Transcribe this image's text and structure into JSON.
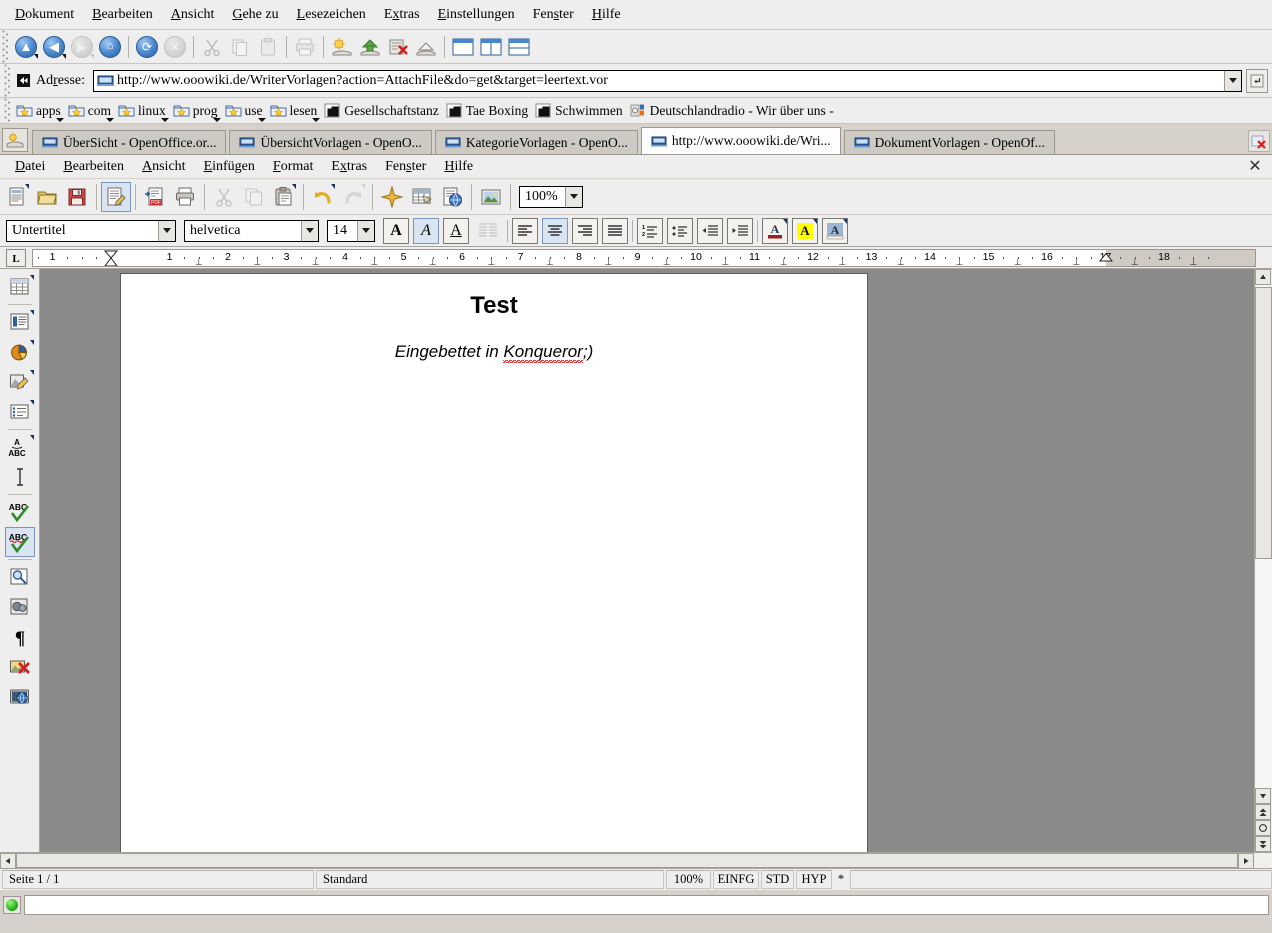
{
  "konqueror": {
    "menu": [
      "Dokument",
      "Bearbeiten",
      "Ansicht",
      "Gehe zu",
      "Lesezeichen",
      "Extras",
      "Einstellungen",
      "Fenster",
      "Hilfe"
    ],
    "toolbar_icons": [
      "up-icon",
      "back-icon",
      "forward-icon",
      "home-icon",
      "reload-icon",
      "stop-icon",
      "cut-icon",
      "copy-icon",
      "paste-icon",
      "print-icon",
      "new-window-icon",
      "save-icon",
      "close-icon",
      "open-icon",
      "view-single-icon",
      "view-split-vertical-icon",
      "view-split-horizontal-icon"
    ],
    "address": {
      "label": "Adresse:",
      "value": "http://www.ooowiki.de/WriterVorlagen?action=AttachFile&do=get&target=leertext.vor"
    },
    "bookmarks": [
      {
        "label": "apps",
        "icon": "folder-bookmark-icon",
        "type": "folder"
      },
      {
        "label": "com",
        "icon": "folder-bookmark-icon",
        "type": "folder"
      },
      {
        "label": "linux",
        "icon": "folder-bookmark-icon",
        "type": "folder"
      },
      {
        "label": "prog",
        "icon": "folder-bookmark-icon",
        "type": "folder"
      },
      {
        "label": "use",
        "icon": "folder-bookmark-icon",
        "type": "folder"
      },
      {
        "label": "lesen",
        "icon": "folder-bookmark-icon",
        "type": "folder"
      },
      {
        "label": "Gesellschaftstanz",
        "icon": "page-dark-icon",
        "type": "link"
      },
      {
        "label": "Tae Boxing",
        "icon": "page-dark-icon",
        "type": "link"
      },
      {
        "label": "Schwimmen",
        "icon": "page-dark-icon",
        "type": "link"
      },
      {
        "label": "Deutschlandradio - Wir über uns -",
        "icon": "dlr-site-icon",
        "type": "link"
      }
    ],
    "tabs": [
      {
        "label": "ÜberSicht - OpenOffice.or...",
        "active": false
      },
      {
        "label": "ÜbersichtVorlagen - OpenO...",
        "active": false
      },
      {
        "label": "KategorieVorlagen - OpenO...",
        "active": false
      },
      {
        "label": "http://www.ooowiki.de/Wri...",
        "active": true
      },
      {
        "label": "DokumentVorlagen - OpenOf...",
        "active": false
      }
    ],
    "status": {
      "text": ""
    }
  },
  "writer": {
    "menu": [
      "Datei",
      "Bearbeiten",
      "Ansicht",
      "Einfügen",
      "Format",
      "Extras",
      "Fenster",
      "Hilfe"
    ],
    "close_label": "✕",
    "standard_toolbar": [
      {
        "name": "new-document-icon",
        "dropdown": true,
        "disabled": false
      },
      {
        "name": "open-document-icon",
        "dropdown": false,
        "disabled": false
      },
      {
        "name": "save-document-icon",
        "dropdown": false,
        "disabled": false
      },
      {
        "name": "edit-file-icon",
        "dropdown": false,
        "disabled": false,
        "pressed": true
      },
      {
        "name": "export-pdf-icon",
        "dropdown": false,
        "disabled": false
      },
      {
        "name": "print-icon",
        "dropdown": false,
        "disabled": false
      },
      {
        "name": "cut-icon",
        "dropdown": false,
        "disabled": true
      },
      {
        "name": "copy-icon",
        "dropdown": false,
        "disabled": true
      },
      {
        "name": "paste-icon",
        "dropdown": true,
        "disabled": false
      },
      {
        "name": "undo-icon",
        "dropdown": true,
        "disabled": false
      },
      {
        "name": "redo-icon",
        "dropdown": true,
        "disabled": true
      },
      {
        "name": "navigator-star-icon",
        "dropdown": false,
        "disabled": false
      },
      {
        "name": "insert-table-icon",
        "dropdown": false,
        "disabled": false
      },
      {
        "name": "hyperlink-icon",
        "dropdown": false,
        "disabled": false
      },
      {
        "name": "insert-image-icon",
        "dropdown": false,
        "disabled": false
      }
    ],
    "zoom": {
      "value": "100%"
    },
    "format": {
      "paragraph_style": "Untertitel",
      "font_name": "helvetica",
      "font_size": "14",
      "bold_label": "A",
      "italic_label": "A",
      "underline_label": "A",
      "bold_active": false,
      "italic_active": true,
      "underline_active": false,
      "align_left_active": false,
      "align_center_active": true,
      "align_right_active": false,
      "align_justify_active": false,
      "font_color": "#9e1f1f",
      "highlight_color": "#ffff00",
      "background_color": "#9fb6d0"
    },
    "ruler": {
      "unit_max": 18,
      "left_indent": 1.0,
      "right_indent": 17.0,
      "tab_char": "L",
      "labels": [
        "1",
        "1",
        "2",
        "3",
        "4",
        "5",
        "6",
        "7",
        "8",
        "9",
        "10",
        "11",
        "12",
        "13",
        "14",
        "15",
        "16",
        "17",
        "18"
      ]
    },
    "left_toolbar": [
      {
        "name": "insert-table-icon",
        "dropdown": true
      },
      {
        "name": "insert-frame-icon",
        "dropdown": true
      },
      {
        "name": "insert-chart-icon",
        "dropdown": true
      },
      {
        "name": "insert-draw-icon",
        "dropdown": true
      },
      {
        "name": "insert-field-icon",
        "dropdown": true
      },
      {
        "name": "special-character-icon",
        "dropdown": true
      },
      {
        "name": "text-cursor-icon",
        "dropdown": false
      },
      {
        "name": "spellcheck-icon",
        "dropdown": false
      },
      {
        "name": "autospellcheck-icon",
        "dropdown": false,
        "pressed": true
      },
      {
        "name": "find-replace-icon",
        "dropdown": false
      },
      {
        "name": "gallery-icon",
        "dropdown": false
      },
      {
        "name": "formatting-marks-icon",
        "dropdown": false
      },
      {
        "name": "images-off-icon",
        "dropdown": false
      },
      {
        "name": "online-layout-icon",
        "dropdown": false
      }
    ],
    "document": {
      "title": "Test",
      "subtitle_prefix": "Eingebettet in ",
      "subtitle_misspelled": "Konqueror",
      "subtitle_suffix": ";)"
    },
    "status": {
      "page": "Seite 1 / 1",
      "style": "Standard",
      "zoom": "100%",
      "insert_mode": "EINFG",
      "selection_mode": "STD",
      "hyperlink_mode": "HYP",
      "modified": "*"
    }
  }
}
